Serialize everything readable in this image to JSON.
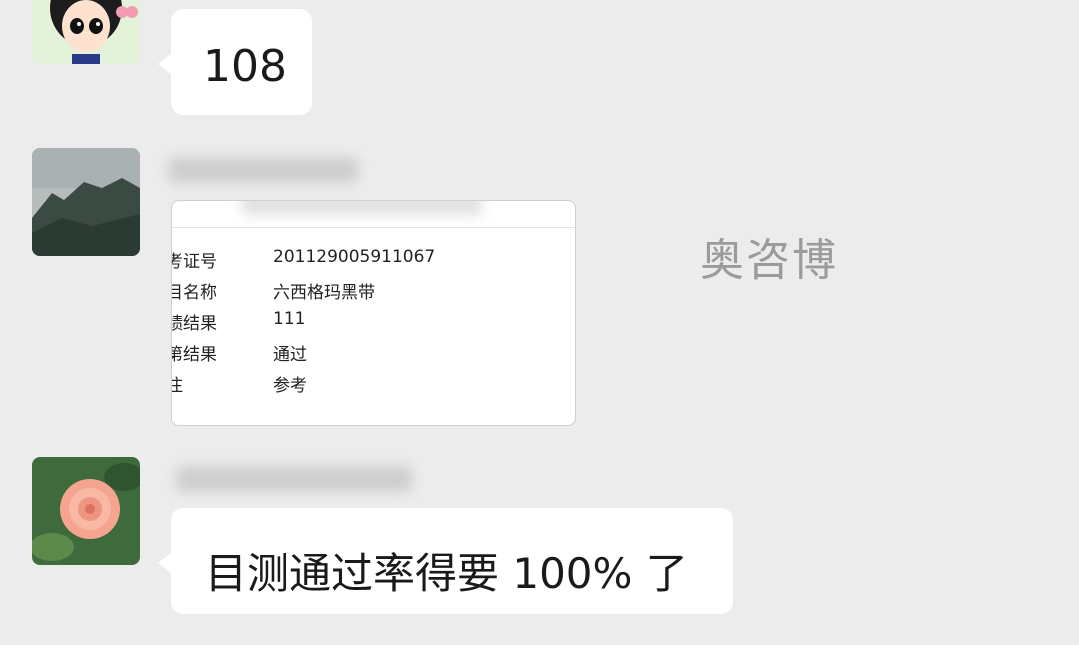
{
  "messages": [
    {
      "text": "108"
    },
    {
      "card": {
        "rows": [
          {
            "label": "考证号",
            "value": "201129005911067"
          },
          {
            "label": "目名称",
            "value": "六西格玛黑带"
          },
          {
            "label": "绩结果",
            "value": "111"
          },
          {
            "label": "第结果",
            "value": "通过"
          },
          {
            "label": "注",
            "value": "参考"
          }
        ]
      }
    },
    {
      "text": "目测通过率得要 100% 了"
    }
  ],
  "watermark": "奥咨博"
}
